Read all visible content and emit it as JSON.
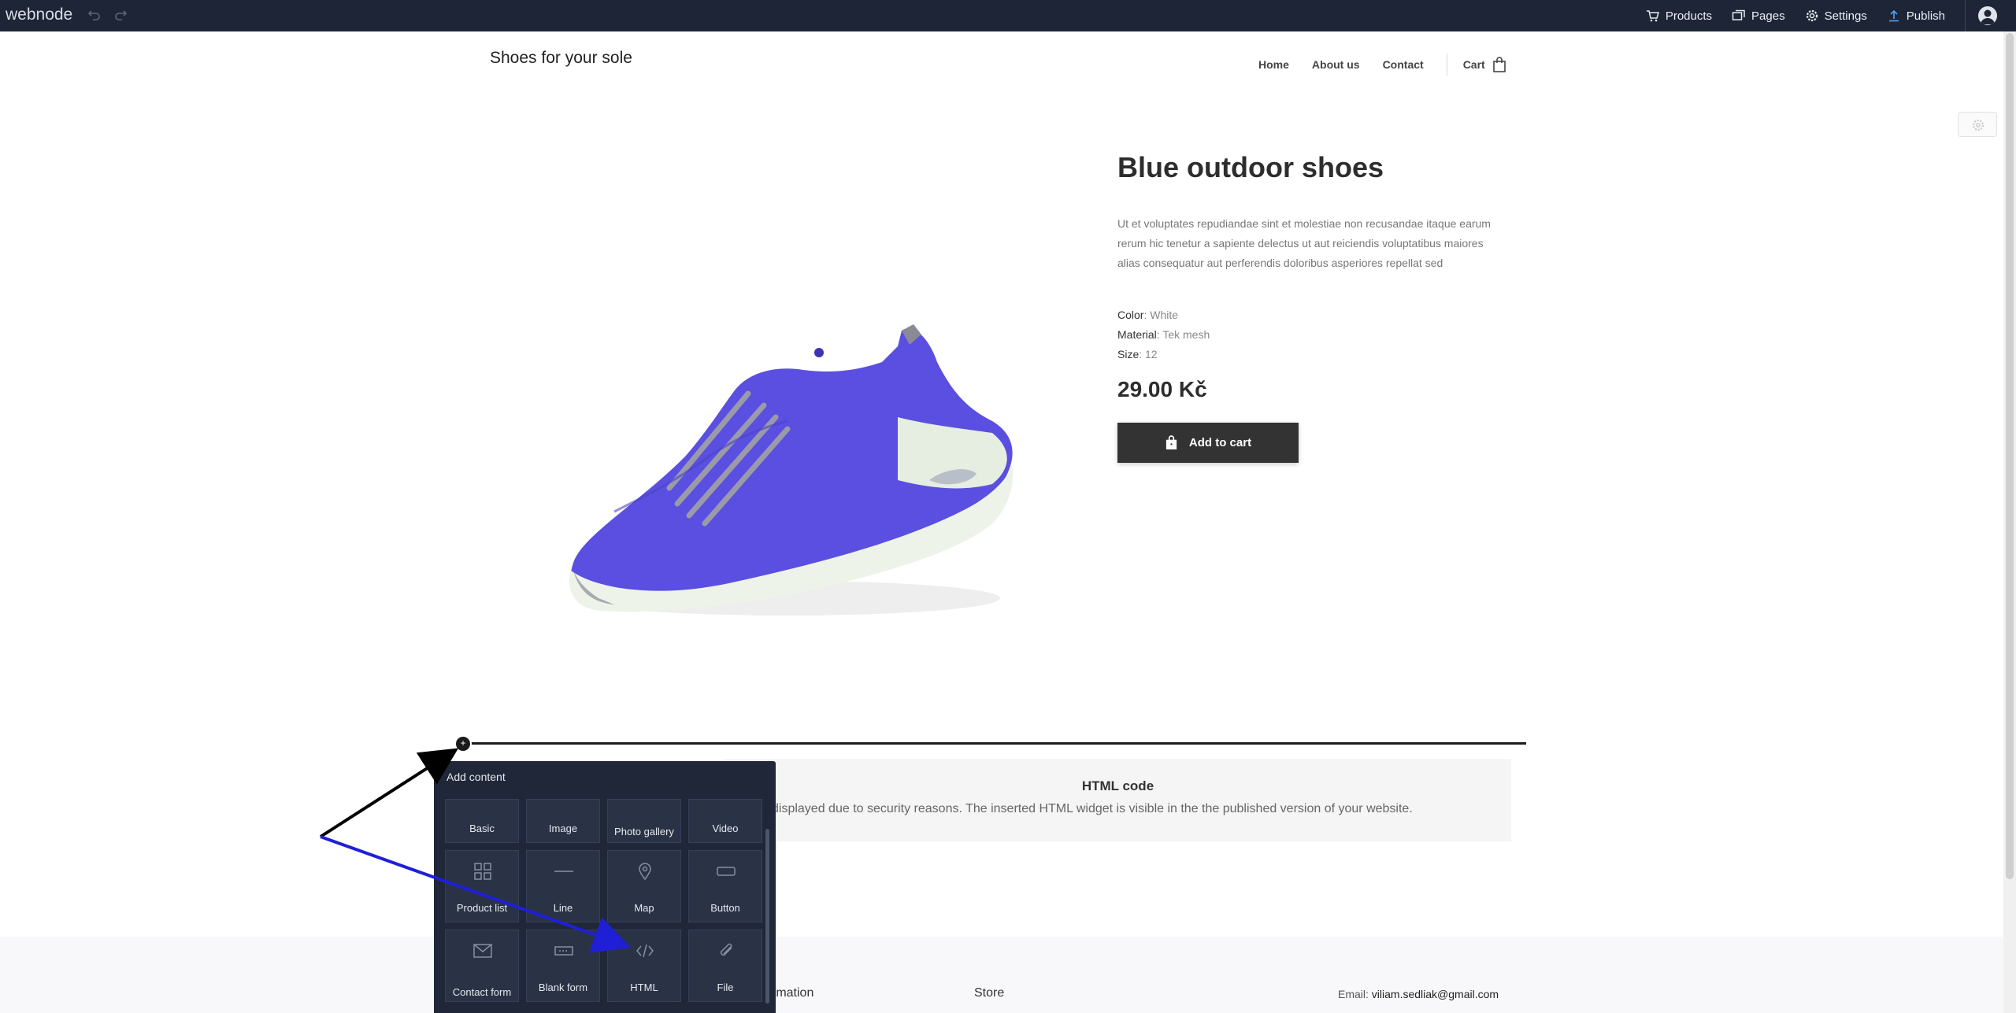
{
  "topbar": {
    "logo": "webnode",
    "products": "Products",
    "pages": "Pages",
    "settings": "Settings",
    "publish": "Publish"
  },
  "site": {
    "title": "Shoes for your sole",
    "nav": [
      "Home",
      "About us",
      "Contact"
    ],
    "cart": "Cart"
  },
  "product": {
    "title": "Blue outdoor shoes",
    "description": "Ut et voluptates repudiandae sint et molestiae non recusandae itaque earum rerum hic tenetur a sapiente delectus ut aut reiciendis voluptatibus maiores alias consequatur aut perferendis doloribus asperiores repellat sed",
    "attributes": [
      {
        "label": "Color",
        "value": ": White"
      },
      {
        "label": "Material",
        "value": ": Tek mesh"
      },
      {
        "label": "Size",
        "value": ": 12"
      }
    ],
    "price": "29.00 Kč",
    "add_to_cart": "Add to cart"
  },
  "insert_marker": "+",
  "html_widget": {
    "title": "HTML code",
    "description": "displayed due to security reasons. The inserted HTML widget is visible in the the published version of your website."
  },
  "footer": {
    "information": "rmation",
    "store": "Store",
    "email_label": "Email: ",
    "email": "viliam.sedliak@gmail.com"
  },
  "add_content": {
    "title": "Add content",
    "tiles": [
      {
        "label": "Basic",
        "icon": "text-icon"
      },
      {
        "label": "Image",
        "icon": "image-icon"
      },
      {
        "label": "Photo gallery",
        "icon": "gallery-icon"
      },
      {
        "label": "Video",
        "icon": "video-icon"
      },
      {
        "label": "Product list",
        "icon": "grid-icon"
      },
      {
        "label": "Line",
        "icon": "line-icon"
      },
      {
        "label": "Map",
        "icon": "map-pin-icon"
      },
      {
        "label": "Button",
        "icon": "button-icon"
      },
      {
        "label": "Contact form",
        "icon": "envelope-icon"
      },
      {
        "label": "Blank form",
        "icon": "form-field-icon"
      },
      {
        "label": "HTML",
        "icon": "code-icon"
      },
      {
        "label": "File",
        "icon": "paperclip-icon"
      }
    ]
  },
  "colors": {
    "topbar": "#1d2536",
    "shoe": "#5a4fe0",
    "button": "#333333",
    "panel": "#1f2738",
    "arrow_black": "#000000",
    "arrow_blue": "#1f1fd6"
  }
}
